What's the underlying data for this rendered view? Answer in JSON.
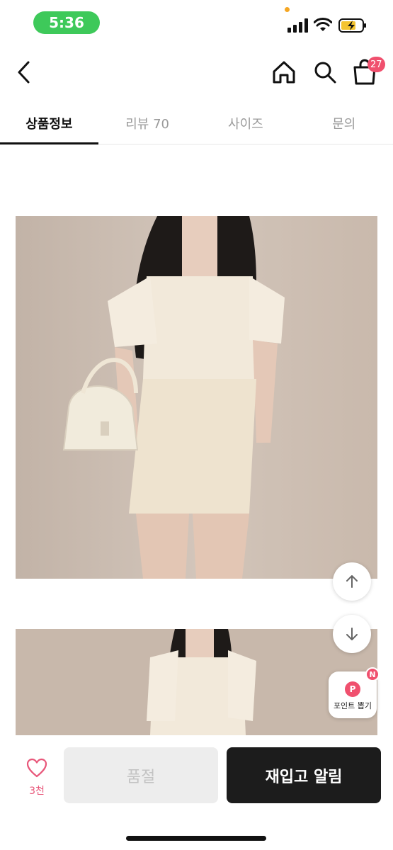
{
  "status_bar": {
    "time": "5:36"
  },
  "header": {
    "cart_count": "27",
    "icons": [
      "back-icon",
      "home-icon",
      "search-icon",
      "cart-icon"
    ]
  },
  "tabs": [
    {
      "label": "상품정보",
      "active": true
    },
    {
      "label": "리뷰 70",
      "active": false
    },
    {
      "label": "사이즈",
      "active": false
    },
    {
      "label": "문의",
      "active": false
    }
  ],
  "floating": {
    "point_badge_letter": "P",
    "point_new_letter": "N",
    "point_label": "포인트 뽑기"
  },
  "bottom_bar": {
    "like_count": "3천",
    "soldout_label": "품절",
    "restock_label": "재입고 알림"
  },
  "colors": {
    "accent_pink": "#f0506e",
    "status_green": "#3ec95a",
    "dark_button": "#1c1c1c"
  }
}
